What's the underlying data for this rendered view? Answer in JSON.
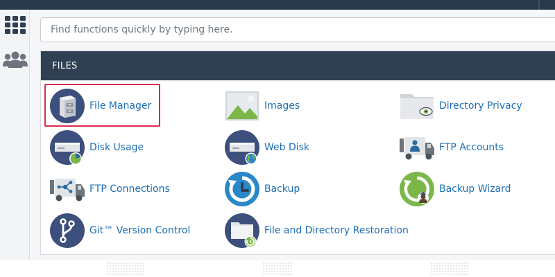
{
  "search": {
    "placeholder": "Find functions quickly by typing here."
  },
  "sidebar": {
    "items": [
      {
        "icon": "grid-icon"
      },
      {
        "icon": "users-icon"
      }
    ]
  },
  "files_section": {
    "title": "FILES",
    "items": [
      {
        "label": "File Manager",
        "icon": "file-manager-icon",
        "highlighted": true
      },
      {
        "label": "Images",
        "icon": "images-icon"
      },
      {
        "label": "Directory Privacy",
        "icon": "directory-privacy-icon"
      },
      {
        "label": "Disk Usage",
        "icon": "disk-usage-icon"
      },
      {
        "label": "Web Disk",
        "icon": "web-disk-icon"
      },
      {
        "label": "FTP Accounts",
        "icon": "ftp-accounts-icon"
      },
      {
        "label": "FTP Connections",
        "icon": "ftp-connections-icon"
      },
      {
        "label": "Backup",
        "icon": "backup-icon"
      },
      {
        "label": "Backup Wizard",
        "icon": "backup-wizard-icon"
      },
      {
        "label": "Git™ Version Control",
        "icon": "git-icon"
      },
      {
        "label": "File and Directory Restoration",
        "icon": "file-restoration-icon"
      }
    ]
  },
  "colors": {
    "header_bg": "#2f4052",
    "link": "#1e6eb5",
    "highlight": "#dc2c4a",
    "icon_navy": "#3d4f7c",
    "icon_blue": "#2b87c7",
    "icon_green": "#7ab648"
  }
}
